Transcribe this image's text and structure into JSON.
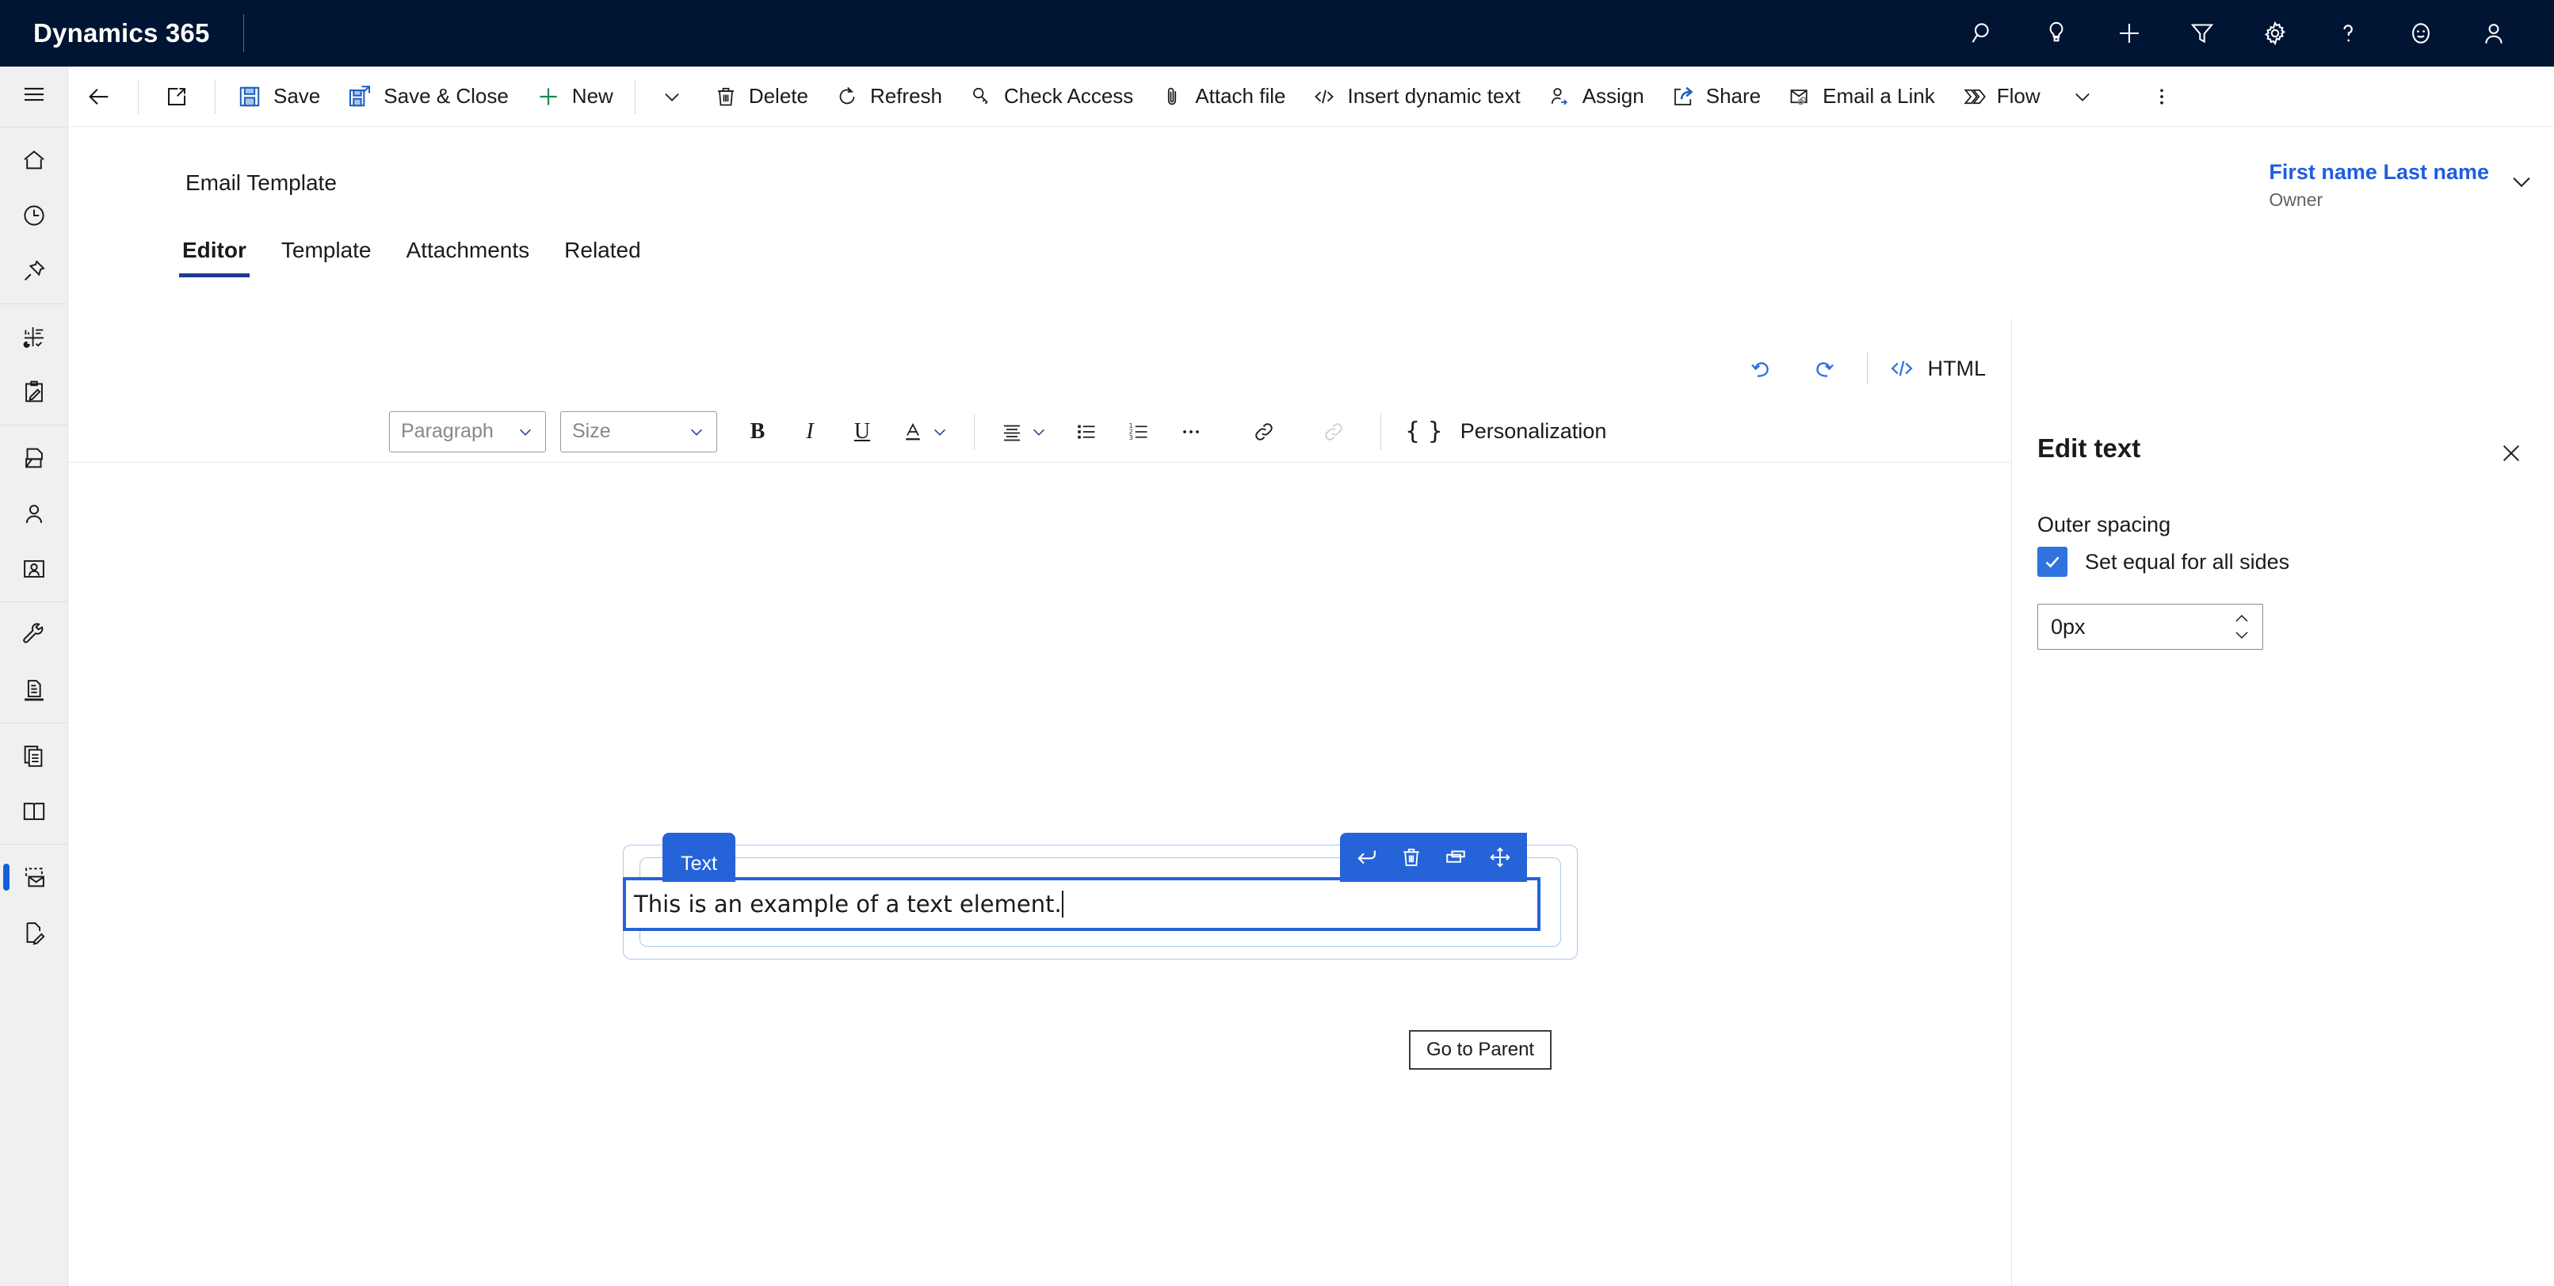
{
  "topnav": {
    "brand": "Dynamics 365",
    "icons": [
      {
        "name": "search-icon",
        "label": "Search"
      },
      {
        "name": "lightbulb-icon",
        "label": "Assistant"
      },
      {
        "name": "plus-icon",
        "label": "Quick create"
      },
      {
        "name": "filter-icon",
        "label": "Filter"
      },
      {
        "name": "gear-icon",
        "label": "Settings"
      },
      {
        "name": "help-icon",
        "label": "Help"
      },
      {
        "name": "smiley-icon",
        "label": "Feedback"
      },
      {
        "name": "person-icon",
        "label": "Account"
      }
    ]
  },
  "rail": {
    "items": [
      {
        "name": "hamburger-icon",
        "label": "Site map"
      },
      {
        "name": "home-icon",
        "label": "Home"
      },
      {
        "name": "recent-icon",
        "label": "Recent"
      },
      {
        "name": "pin-icon",
        "label": "Pinned"
      },
      {
        "name": "dashboard-icon",
        "label": "Dashboards"
      },
      {
        "name": "activities-icon",
        "label": "Activities"
      },
      {
        "name": "files-icon",
        "label": "Files"
      },
      {
        "name": "contact-icon",
        "label": "Contacts"
      },
      {
        "name": "account-card-icon",
        "label": "Accounts"
      },
      {
        "name": "wrench-icon",
        "label": "Settings"
      },
      {
        "name": "import-icon",
        "label": "Imports"
      },
      {
        "name": "documents-icon",
        "label": "Documents"
      },
      {
        "name": "book-icon",
        "label": "Knowledge"
      },
      {
        "name": "email-template-icon",
        "label": "Email Templates",
        "selected": true
      },
      {
        "name": "document-edit-icon",
        "label": "Drafts"
      }
    ]
  },
  "commandbar": {
    "back_label": "Back",
    "popout_label": "Open in new window",
    "items": [
      {
        "name": "save-button",
        "label": "Save",
        "icon": "save-icon"
      },
      {
        "name": "save-and-close-button",
        "label": "Save & Close",
        "icon": "save-close-icon"
      },
      {
        "name": "new-button",
        "label": "New",
        "icon": "plus-icon"
      },
      {
        "name": "delete-button",
        "label": "Delete",
        "icon": "trash-icon"
      },
      {
        "name": "refresh-button",
        "label": "Refresh",
        "icon": "refresh-icon"
      },
      {
        "name": "check-access-button",
        "label": "Check Access",
        "icon": "key-icon"
      },
      {
        "name": "attach-file-button",
        "label": "Attach file",
        "icon": "paperclip-icon"
      },
      {
        "name": "insert-dynamic-text-button",
        "label": "Insert dynamic text",
        "icon": "code-icon"
      },
      {
        "name": "assign-button",
        "label": "Assign",
        "icon": "assign-icon"
      },
      {
        "name": "share-button",
        "label": "Share",
        "icon": "share-icon"
      },
      {
        "name": "email-a-link-button",
        "label": "Email a Link",
        "icon": "envelope-link-icon"
      },
      {
        "name": "flow-button",
        "label": "Flow",
        "icon": "flow-icon"
      }
    ],
    "overflow_label": "More commands"
  },
  "page": {
    "record_title": "Email Template",
    "owner_name": "First name Last name",
    "owner_label": "Owner",
    "tabs": [
      {
        "label": "Editor",
        "active": true
      },
      {
        "label": "Template",
        "active": false
      },
      {
        "label": "Attachments",
        "active": false
      },
      {
        "label": "Related",
        "active": false
      }
    ]
  },
  "editor": {
    "undo_label": "Undo",
    "redo_label": "Redo",
    "html_label": "HTML",
    "toolbar": {
      "paragraph_placeholder": "Paragraph",
      "size_placeholder": "Size",
      "bold_label": "B",
      "italic_label": "I",
      "underline_label": "U",
      "font_color_label": "A",
      "more_label": "...",
      "personalization_label": "Personalization",
      "personalization_glyph": "{ }"
    },
    "selected_element": {
      "badge_label": "Text",
      "content": "This is an example of a text element.",
      "actions": [
        {
          "name": "go-to-parent-button",
          "label": "Go to Parent"
        },
        {
          "name": "delete-element-button",
          "label": "Delete"
        },
        {
          "name": "duplicate-element-button",
          "label": "Duplicate"
        },
        {
          "name": "move-element-button",
          "label": "Move"
        }
      ],
      "tooltip": "Go to Parent"
    }
  },
  "right_panel": {
    "title": "Edit text",
    "close_label": "Close",
    "section_label": "Outer spacing",
    "checkbox_label": "Set equal for all sides",
    "checkbox_checked": true,
    "spacing_value": "0px"
  },
  "colors": {
    "nav_background": "#001433",
    "accent_blue": "#2563d8",
    "link_blue": "#1f5ede",
    "tab_underline": "#1f3a93",
    "rail_background": "#f0f0f0",
    "selection_border": "#a8c8ea"
  }
}
